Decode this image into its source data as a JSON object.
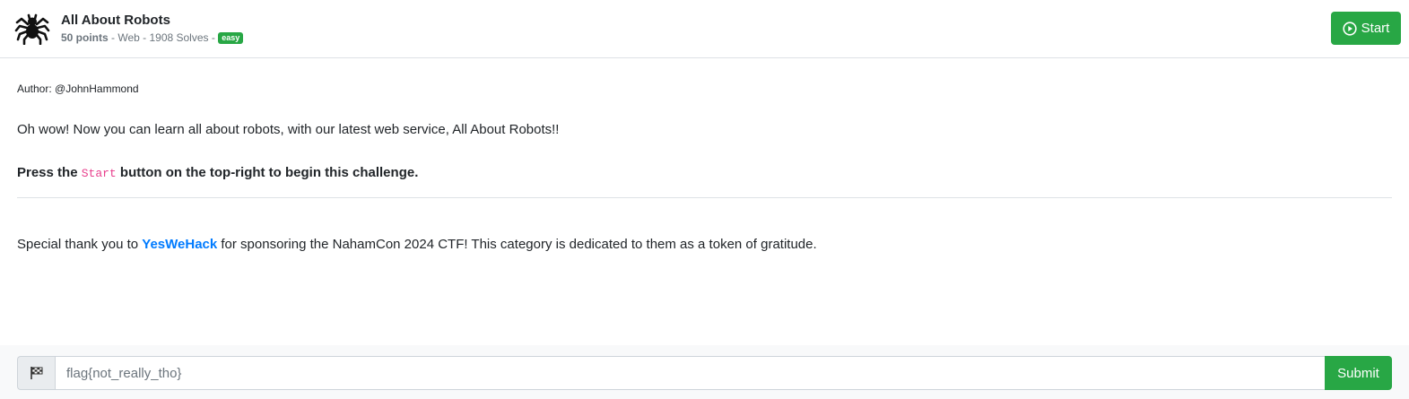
{
  "challenge": {
    "title": "All About Robots",
    "points": "50 points",
    "meta_rest": " - Web - 1908 Solves - ",
    "difficulty": "easy",
    "icon": "spider-icon"
  },
  "start_button": {
    "label": "Start",
    "icon": "play-circle-icon"
  },
  "body": {
    "author": "Author: @JohnHammond",
    "description": "Oh wow! Now you can learn all about robots, with our latest web service, All About Robots!!",
    "press_before": "Press the ",
    "press_code": "Start",
    "press_after": " button on the top-right to begin this challenge.",
    "thanks_before": "Special thank you to ",
    "thanks_link": "YesWeHack",
    "thanks_after": " for sponsoring the NahamCon 2024 CTF! This category is dedicated to them as a token of gratitude."
  },
  "flag_form": {
    "placeholder": "flag{not_really_tho}",
    "value": "",
    "submit_label": "Submit",
    "icon": "flag-checkered-icon"
  },
  "colors": {
    "accent_green": "#28a745",
    "link_blue": "#007bff",
    "code_pink": "#e83e8c"
  }
}
